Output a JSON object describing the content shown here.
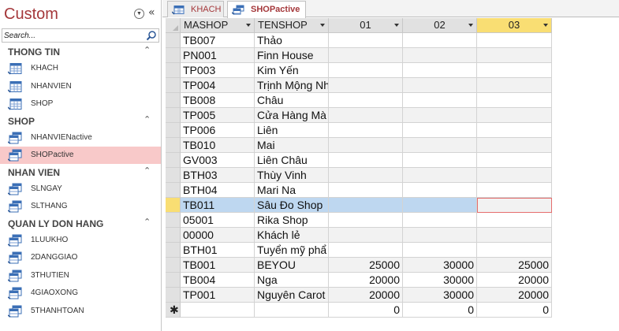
{
  "nav": {
    "title": "Custom",
    "search_placeholder": "Search...",
    "groups": [
      {
        "label": "THONG TIN",
        "chevron": "⌃",
        "items": [
          {
            "label": "KHACH",
            "icon": "table-icon"
          },
          {
            "label": "NHANVIEN",
            "icon": "table-icon"
          },
          {
            "label": "SHOP",
            "icon": "table-icon"
          }
        ]
      },
      {
        "label": "SHOP",
        "chevron": "⌃",
        "items": [
          {
            "label": "NHANVIENactive",
            "icon": "query-icon"
          },
          {
            "label": "SHOPactive",
            "icon": "query-icon",
            "selected": true
          }
        ]
      },
      {
        "label": "NHAN VIEN",
        "chevron": "⌃",
        "items": [
          {
            "label": "SLNGAY",
            "icon": "query-icon"
          },
          {
            "label": "SLTHANG",
            "icon": "query-icon"
          }
        ]
      },
      {
        "label": "QUAN LY DON HANG",
        "chevron": "⌃",
        "items": [
          {
            "label": "1LUUKHO",
            "icon": "query-icon"
          },
          {
            "label": "2DANGGIAO",
            "icon": "query-icon"
          },
          {
            "label": "3THUTIEN",
            "icon": "query-icon"
          },
          {
            "label": "4GIAOXONG",
            "icon": "query-icon"
          },
          {
            "label": "5THANHTOAN",
            "icon": "query-icon"
          }
        ]
      }
    ]
  },
  "tabs": [
    {
      "label": "KHACH",
      "icon": "table-icon",
      "active": false
    },
    {
      "label": "SHOPactive",
      "icon": "query-icon",
      "active": true
    }
  ],
  "grid": {
    "columns": [
      "MASHOP",
      "TENSHOP",
      "01",
      "02",
      "03"
    ],
    "selected_column": "03",
    "rows": [
      [
        "TB007",
        "Thảo",
        "",
        "",
        ""
      ],
      [
        "PN001",
        "Finn House",
        "",
        "",
        ""
      ],
      [
        "TP003",
        "Kim Yến",
        "",
        "",
        ""
      ],
      [
        "TP004",
        "Trịnh Mộng Nh",
        "",
        "",
        ""
      ],
      [
        "TB008",
        "Châu",
        "",
        "",
        ""
      ],
      [
        "TP005",
        "Cửa Hàng Mà",
        "",
        "",
        ""
      ],
      [
        "TP006",
        "Liên",
        "",
        "",
        ""
      ],
      [
        "TB010",
        "Mai",
        "",
        "",
        ""
      ],
      [
        "GV003",
        "Liên Châu",
        "",
        "",
        ""
      ],
      [
        "BTH03",
        "Thùy Vinh",
        "",
        "",
        ""
      ],
      [
        "BTH04",
        "Mari Na",
        "",
        "",
        ""
      ],
      [
        "TB011",
        "Sâu Đo Shop",
        "",
        "",
        ""
      ],
      [
        "05001",
        "Rika Shop",
        "",
        "",
        ""
      ],
      [
        "00000",
        "Khách lẻ",
        "",
        "",
        ""
      ],
      [
        "BTH01",
        "Tuyển mỹ phẩ",
        "",
        "",
        ""
      ],
      [
        "TB001",
        "BEYOU",
        "25000",
        "30000",
        "25000"
      ],
      [
        "TB004",
        "Nga",
        "20000",
        "30000",
        "20000"
      ],
      [
        "TP001",
        "Nguyên Carot",
        "20000",
        "30000",
        "20000"
      ]
    ],
    "current_row_index": 11,
    "new_row": {
      "marker": "✱",
      "values": [
        "",
        "",
        "0",
        "0",
        "0"
      ]
    }
  },
  "colors": {
    "accent": "#a4373a",
    "selected_nav": "#f8c9c9",
    "selected_row": "#bed7f0",
    "selected_header": "#f9de73"
  }
}
